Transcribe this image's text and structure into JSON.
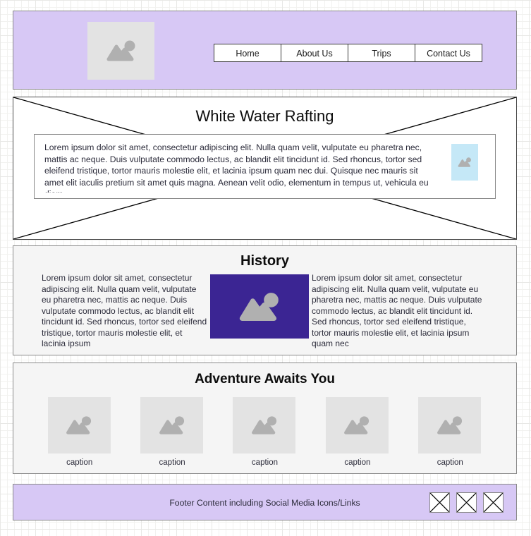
{
  "colors": {
    "header_bg": "#d7c8f5",
    "footer_bg": "#d7c8f5",
    "section_bg": "#f5f5f5",
    "placeholder_gray": "#e3e3e3",
    "placeholder_glyph": "#b0b0b0",
    "history_image_bg": "#3b2593",
    "hero_image_bg": "#c5e8f7",
    "border": "#8a8a8a",
    "text": "#2b2b3a"
  },
  "header": {
    "logo": {
      "icon": "image-placeholder-icon"
    },
    "nav": [
      {
        "label": "Home"
      },
      {
        "label": "About Us"
      },
      {
        "label": "Trips"
      },
      {
        "label": "Contact Us"
      }
    ]
  },
  "hero": {
    "title": "White Water Rafting",
    "body": "Lorem ipsum dolor sit amet, consectetur adipiscing elit. Nulla quam velit, vulputate eu pharetra nec, mattis ac neque. Duis vulputate commodo lectus, ac blandit elit tincidunt id. Sed rhoncus, tortor sed eleifend tristique, tortor mauris molestie elit, et lacinia ipsum quam nec dui. Quisque nec mauris sit amet elit iaculis pretium sit amet quis magna. Aenean velit odio, elementum in tempus ut, vehicula eu diam.",
    "image": {
      "icon": "image-placeholder-icon"
    }
  },
  "history": {
    "title": "History",
    "left_text": "Lorem ipsum dolor sit amet, consectetur adipiscing elit. Nulla quam velit, vulputate eu pharetra nec, mattis ac neque. Duis vulputate commodo lectus, ac blandit elit tincidunt id. Sed rhoncus, tortor sed eleifend tristique, tortor mauris molestie elit, et lacinia ipsum",
    "right_text": "Lorem ipsum dolor sit amet, consectetur adipiscing elit. Nulla quam velit, vulputate eu pharetra nec, mattis ac neque. Duis vulputate commodo lectus, ac blandit elit tincidunt id. Sed rhoncus, tortor sed eleifend tristique, tortor mauris molestie elit, et lacinia ipsum quam nec",
    "image": {
      "icon": "image-placeholder-icon"
    }
  },
  "gallery": {
    "title": "Adventure Awaits You",
    "items": [
      {
        "caption": "caption",
        "icon": "image-placeholder-icon"
      },
      {
        "caption": "caption",
        "icon": "image-placeholder-icon"
      },
      {
        "caption": "caption",
        "icon": "image-placeholder-icon"
      },
      {
        "caption": "caption",
        "icon": "image-placeholder-icon"
      },
      {
        "caption": "caption",
        "icon": "image-placeholder-icon"
      }
    ]
  },
  "footer": {
    "text": "Footer Content including Social Media Icons/Links",
    "social_icons": [
      {
        "name": "social-icon-1"
      },
      {
        "name": "social-icon-2"
      },
      {
        "name": "social-icon-3"
      }
    ]
  }
}
